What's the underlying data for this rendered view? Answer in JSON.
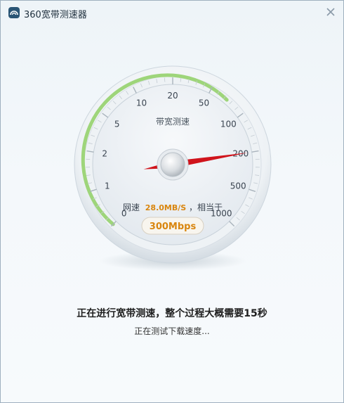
{
  "window": {
    "title": "360宽带测速器",
    "title_icon": "app-logo-icon",
    "close_icon": "close-icon"
  },
  "gauge": {
    "caption": "带宽测速",
    "scale_labels": [
      "0",
      "1",
      "2",
      "5",
      "10",
      "20",
      "50",
      "100",
      "200",
      "500",
      "1000"
    ],
    "needle_value": 200,
    "speed_prefix": "网速",
    "speed_value": "28.0MB/S",
    "speed_suffix": "，相当于",
    "bandwidth": "300Mbps",
    "colors": {
      "accent_arc": "#9ed57a",
      "needle": "#d0141c",
      "speed_value": "#d9860f",
      "badge_text": "#d9860f"
    }
  },
  "status": {
    "main": "正在进行宽带测速，整个过程大概需要15秒",
    "sub": "正在测试下载速度..."
  }
}
